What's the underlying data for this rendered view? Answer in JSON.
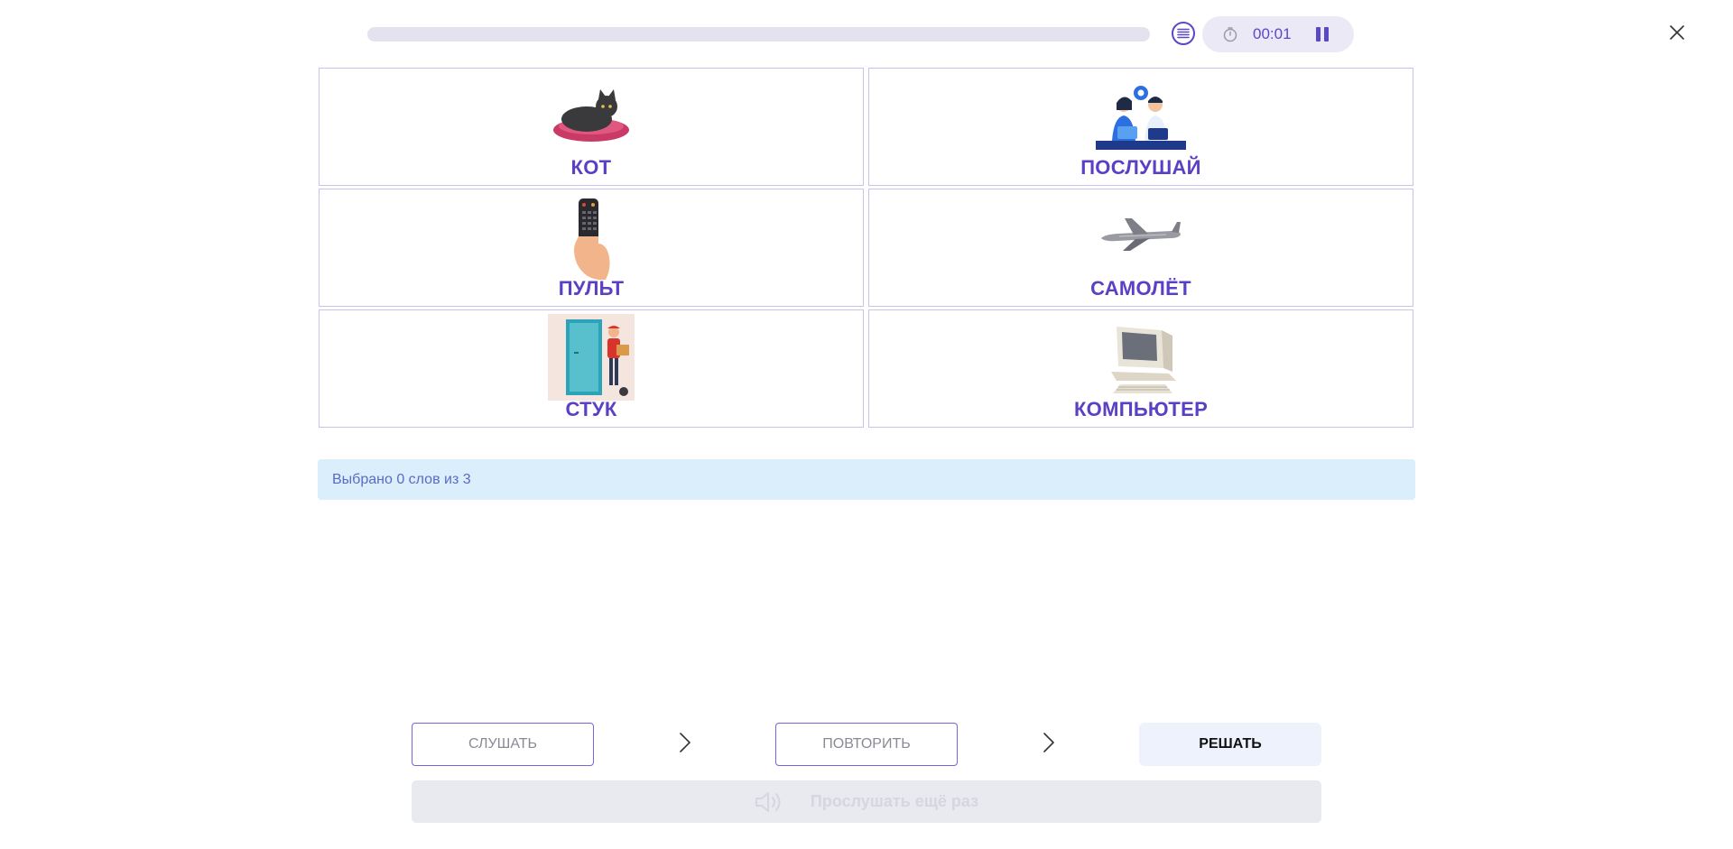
{
  "header": {
    "timer": "00:01",
    "icons": [
      "list-icon",
      "stopwatch-icon",
      "pause-icon",
      "close-icon"
    ]
  },
  "cards": [
    {
      "word": "КОТ",
      "icon": "cat-image"
    },
    {
      "word": "ПОСЛУШАЙ",
      "icon": "people-talking-image"
    },
    {
      "word": "ПУЛЬТ",
      "icon": "remote-control-image"
    },
    {
      "word": "САМОЛЁТ",
      "icon": "airplane-image"
    },
    {
      "word": "СТУК",
      "icon": "door-knock-image"
    },
    {
      "word": "КОМПЬЮТЕР",
      "icon": "computer-image"
    }
  ],
  "status": {
    "text": "Выбрано 0 слов из 3"
  },
  "footer": {
    "listen_label": "СЛУШАТЬ",
    "repeat_label": "ПОВТОРИТЬ",
    "solve_label": "РЕШАТЬ",
    "listen_again_label": "Прослушать ещё раз"
  },
  "colors": {
    "accent": "#5b3fc4",
    "card_border": "#c9c2ec",
    "info_bg": "#daeefb",
    "solve_bg": "#eef2fc",
    "disabled_bg": "#e9eaef"
  }
}
